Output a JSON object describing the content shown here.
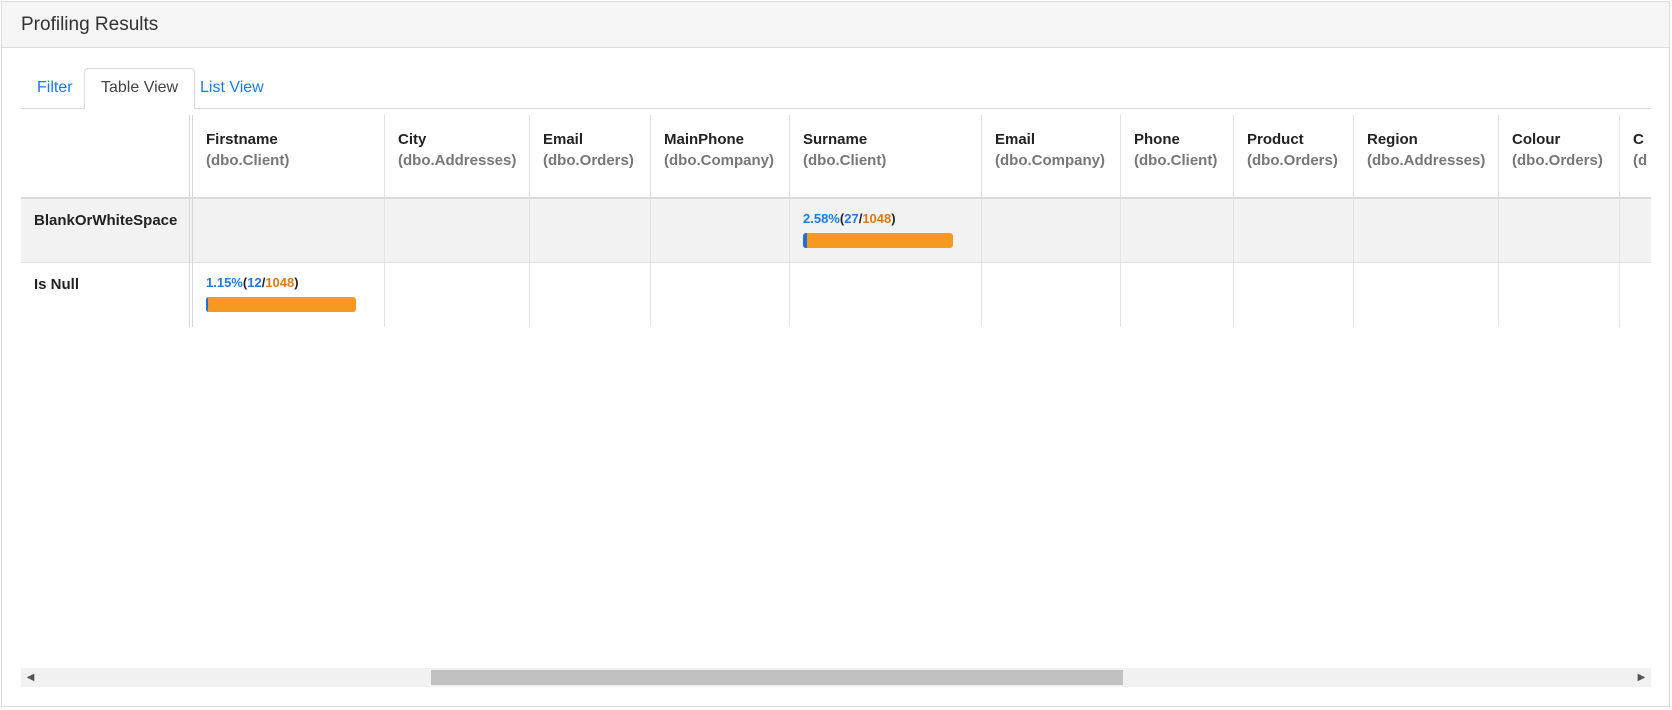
{
  "panel": {
    "title": "Profiling Results"
  },
  "tabs": [
    {
      "label": "Filter",
      "active": false
    },
    {
      "label": "Table View",
      "active": true
    },
    {
      "label": "List View",
      "active": false
    }
  ],
  "table": {
    "columns": [
      {
        "name": "Firstname",
        "table": "(dbo.Client)"
      },
      {
        "name": "City",
        "table": "(dbo.Addresses)"
      },
      {
        "name": "Email",
        "table": "(dbo.Orders)"
      },
      {
        "name": "MainPhone",
        "table": "(dbo.Company)"
      },
      {
        "name": "Surname",
        "table": "(dbo.Client)"
      },
      {
        "name": "Email",
        "table": "(dbo.Company)"
      },
      {
        "name": "Phone",
        "table": "(dbo.Client)"
      },
      {
        "name": "Product",
        "table": "(dbo.Orders)"
      },
      {
        "name": "Region",
        "table": "(dbo.Addresses)"
      },
      {
        "name": "Colour",
        "table": "(dbo.Orders)"
      },
      {
        "name": "C",
        "table": "(d"
      }
    ],
    "rows": [
      {
        "label": "BlankOrWhiteSpace",
        "stats": [
          {
            "column_index": 4,
            "percent": "2.58%",
            "count": "27",
            "total": "1048",
            "fraction": 0.0258
          }
        ]
      },
      {
        "label": "Is Null",
        "stats": [
          {
            "column_index": 0,
            "percent": "1.15%",
            "count": "12",
            "total": "1048",
            "fraction": 0.0115
          }
        ]
      }
    ]
  },
  "scrollbar": {
    "left_arrow_icon": "left-arrow-icon",
    "right_arrow_icon": "right-arrow-icon"
  },
  "colors": {
    "link": "#1e7ae6",
    "bar": "#f7981f",
    "bar_fill": "#1e6fd9",
    "total": "#e07a10"
  }
}
